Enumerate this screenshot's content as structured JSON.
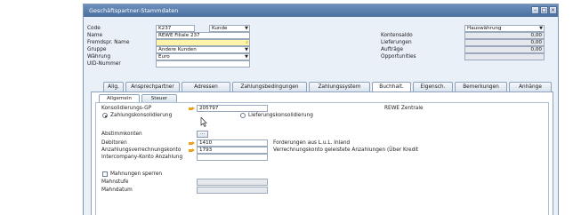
{
  "window": {
    "title": "Geschäftspartner-Stammdaten"
  },
  "header": {
    "code_label": "Code",
    "code_value": "K237",
    "type_value": "Kunde",
    "name_label": "Name",
    "name_value": "REWE Filiale 237",
    "foreign_name_label": "Fremdspr. Name",
    "group_label": "Gruppe",
    "group_value": "Andere Kunden",
    "currency_label": "Währung",
    "currency_value": "Euro",
    "uid_label": "UID-Nummer",
    "currency_mode_value": "Hauswährung",
    "balance_label": "Kontensaldo",
    "balance_value": "0,00",
    "deliveries_label": "Lieferungen",
    "deliveries_value": "0,00",
    "orders_label": "Aufträge",
    "orders_value": "0,00",
    "opportunities_label": "Opportunities"
  },
  "tabs": [
    {
      "label": "Allg."
    },
    {
      "label": "Ansprechpartner"
    },
    {
      "label": "Adressen"
    },
    {
      "label": "Zahlungsbedingungen"
    },
    {
      "label": "Zahlungssystem"
    },
    {
      "label": "Buchhalt."
    },
    {
      "label": "Eigensch."
    },
    {
      "label": "Bemerkungen"
    },
    {
      "label": "Anhänge"
    }
  ],
  "subtabs": [
    {
      "label": "Allgemein"
    },
    {
      "label": "Steuer"
    }
  ],
  "accounting": {
    "consolidation_bp_label": "Konsolidierungs-GP",
    "consolidation_bp_value": "205797",
    "consolidation_bp_name": "REWE Zentrale",
    "payment_consolidation_label": "Zahlungskonsolidierung",
    "delivery_consolidation_label": "Lieferungskonsolidierung",
    "control_accounts_label": "Abstimmkonten",
    "control_accounts_button": "...",
    "debtors_label": "Debitoren",
    "debtors_value": "1410",
    "debtors_desc": "Forderungen aus L.u.L. Inland",
    "down_payment_label": "Anzahlungsverrechnungskonto",
    "down_payment_value": "1793",
    "down_payment_desc": "Verrechnungskonto geleistete Anzahlungen (Über Kredit",
    "intercompany_label": "Intercompany-Konto Anzahlung",
    "block_dunning_label": "Mahnungen sperren",
    "dunning_level_label": "Mahnstufe",
    "dunning_date_label": "Mahndatum"
  }
}
